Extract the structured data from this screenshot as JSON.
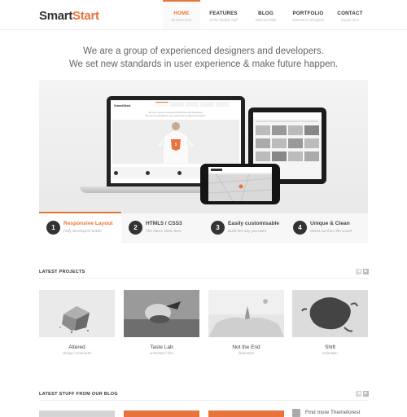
{
  "logo": {
    "part1": "Smart",
    "part2": "Start"
  },
  "nav": [
    {
      "label": "HOME",
      "sub": "all starts here",
      "active": true
    },
    {
      "label": "FEATURES",
      "sub": "all the flexible stuff",
      "active": false
    },
    {
      "label": "BLOG",
      "sub": "what we think",
      "active": false
    },
    {
      "label": "PORTFOLIO",
      "sub": "what we've designed",
      "active": false
    },
    {
      "label": "CONTACT",
      "sub": "inquire here",
      "active": false
    }
  ],
  "tagline": {
    "line1": "We are a group of experienced designers and developers.",
    "line2": "We set new standards in user experience & make future happen."
  },
  "hero": {
    "screen_line1": "We are a group of experienced designers and developers.",
    "screen_line2": "We set new standards in user experience & make future happen.",
    "screen_logo": "SmartStart"
  },
  "features": [
    {
      "num": "1",
      "title": "Responsive Layout",
      "sub": "Fully developed mobile",
      "active": true
    },
    {
      "num": "2",
      "title": "HTML5 / CSS3",
      "sub": "The future starts here",
      "active": false
    },
    {
      "num": "3",
      "title": "Easily customisable",
      "sub": "Build the way you want",
      "active": false
    },
    {
      "num": "4",
      "title": "Unique & Clean",
      "sub": "Stand out from the crowd",
      "active": false
    }
  ],
  "projects_section": {
    "title": "LATEST PROJECTS"
  },
  "projects": [
    {
      "title": "Altered",
      "sub": "design / cinema4d"
    },
    {
      "title": "Taste Lab",
      "sub": "animation / film"
    },
    {
      "title": "Not the End",
      "sub": "illustration"
    },
    {
      "title": "Shift",
      "sub": "animation"
    }
  ],
  "blog_section": {
    "title": "LATEST STUFF FROM OUR BLOG"
  },
  "blog_side": {
    "text": "Find more Themeforest"
  },
  "colors": {
    "accent": "#e8743b",
    "dark": "#333333",
    "muted": "#aaaaaa"
  }
}
